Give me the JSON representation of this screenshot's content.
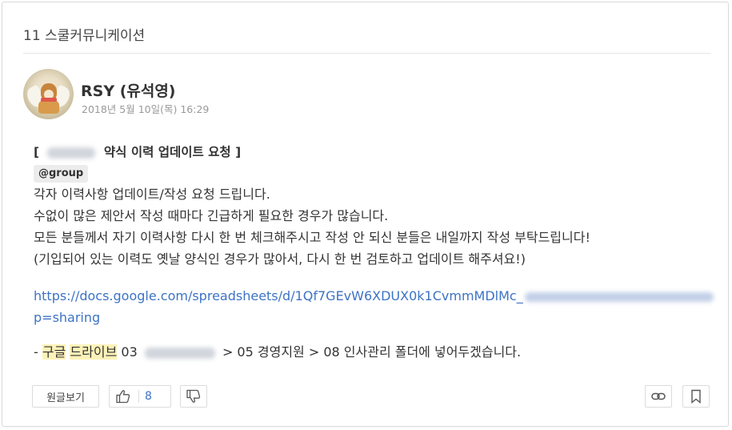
{
  "header": {
    "title": "11 스쿨커뮤니케이션"
  },
  "post": {
    "author": "RSY (유석영)",
    "date": "2018년 5월 10일(목) 16:29",
    "title_open": "[",
    "title_text": "약식 이력 업데이트 요청 ]",
    "mention": "@group",
    "lines": [
      "각자 이력사항 업데이트/작성 요청 드립니다.",
      "수없이 많은 제안서 작성 때마다 긴급하게 필요한 경우가 많습니다.",
      "모든 분들께서 자기 이력사항 다시 한 번 체크해주시고 작성 안 되신 분들은 내일까지 작성 부탁드립니다!",
      "(기입되어 있는 이력도 옛날 양식인 경우가 많아서, 다시 한 번 검토하고 업데이트 해주셔요!)"
    ],
    "link_visible": "https://docs.google.com/spreadsheets/d/1Qf7GEvW6XDUX0k1CvmmMDlMc_",
    "link_tail": "p=sharing",
    "drive_prefix": "- ",
    "drive_hl1": "구글",
    "drive_hl2": "드라이브",
    "drive_num": "03",
    "drive_rest": "> 05 경영지원 > 08 인사관리 폴더에 넣어두겠습니다."
  },
  "actions": {
    "view_original": "원글보기",
    "like_count": "8"
  },
  "icons": {
    "like": "thumbs-up-icon",
    "dislike": "thumbs-down-icon",
    "link": "link-icon",
    "bookmark": "bookmark-icon"
  },
  "colors": {
    "link": "#3d73c5",
    "highlight": "#fdf2b8"
  }
}
